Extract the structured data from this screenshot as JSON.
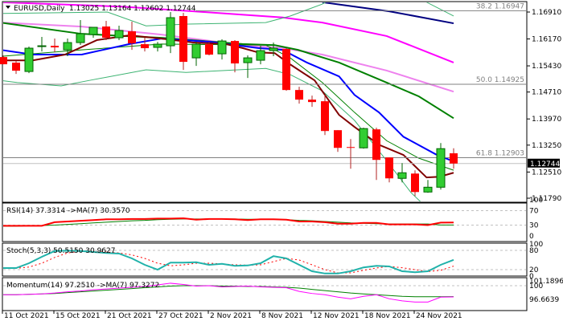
{
  "header": {
    "arrow_icon": "triangle-down-icon",
    "symbol": "EURUSD,Daily",
    "ohlc": "1.13025 1.13164 1.12602 1.12744"
  },
  "price_axis": {
    "ticks": [
      "1.16910",
      "1.16170",
      "1.15430",
      "1.14710",
      "1.13970",
      "1.13250",
      "1.12510",
      "1.11790"
    ],
    "tick_values": [
      1.1691,
      1.1617,
      1.1543,
      1.1471,
      1.1397,
      1.1325,
      1.1251,
      1.1179
    ],
    "current_price": "1.12744",
    "current_value": 1.12744
  },
  "fibo": [
    {
      "label": "38.2 1.16947",
      "value": 1.16947
    },
    {
      "label": "50.0 1.14925",
      "value": 1.14925
    },
    {
      "label": "61.8 1.12903",
      "value": 1.12903
    }
  ],
  "dates": [
    {
      "label": "11 Oct 2021",
      "idx": 0
    },
    {
      "label": "15 Oct 2021",
      "idx": 4
    },
    {
      "label": "21 Oct 2021",
      "idx": 8
    },
    {
      "label": "27 Oct 2021",
      "idx": 12
    },
    {
      "label": "2 Nov 2021",
      "idx": 16
    },
    {
      "label": "8 Nov 2021",
      "idx": 20
    },
    {
      "label": "12 Nov 2021",
      "idx": 24
    },
    {
      "label": "18 Nov 2021",
      "idx": 28
    },
    {
      "label": "24 Nov 2021",
      "idx": 32
    }
  ],
  "colors": {
    "bull": "#32cd32",
    "bear": "#ff0000",
    "outline": "#006400",
    "navy": "#000080",
    "magenta": "#ff00ff",
    "violet": "#ee82ee",
    "green": "#008000",
    "blue": "#0000ff",
    "maroon": "#800000",
    "bb": "#3cb371",
    "stoch": "#20b2aa",
    "grid": "#c0c0c0"
  },
  "chart_data": {
    "type": "candlestick",
    "title": "EURUSD,Daily",
    "ylim": [
      1.115,
      1.1725
    ],
    "candles": [
      [
        1.15672,
        1.15716,
        1.15474,
        1.15474
      ],
      [
        1.15518,
        1.15562,
        1.15208,
        1.15297
      ],
      [
        1.15275,
        1.1596,
        1.1523,
        1.15916
      ],
      [
        1.1596,
        1.16225,
        1.15827,
        1.15982
      ],
      [
        1.15982,
        1.16181,
        1.15805,
        1.15938
      ],
      [
        1.15871,
        1.16181,
        1.15695,
        1.1607
      ],
      [
        1.1607,
        1.16689,
        1.16004,
        1.16313
      ],
      [
        1.16291,
        1.16402,
        1.16203,
        1.1649
      ],
      [
        1.16512,
        1.16667,
        1.16137,
        1.16203
      ],
      [
        1.16203,
        1.16534,
        1.16137,
        1.16402
      ],
      [
        1.1638,
        1.16645,
        1.15871,
        1.16048
      ],
      [
        1.16026,
        1.16203,
        1.15827,
        1.15916
      ],
      [
        1.15938,
        1.16092,
        1.15827,
        1.16026
      ],
      [
        1.15982,
        1.1691,
        1.15783,
        1.16755
      ],
      [
        1.168,
        1.16888,
        1.15319,
        1.1554
      ],
      [
        1.1565,
        1.16092,
        1.15429,
        1.16026
      ],
      [
        1.16026,
        1.16092,
        1.15717,
        1.15739
      ],
      [
        1.15761,
        1.16159,
        1.15606,
        1.16114
      ],
      [
        1.16114,
        1.16137,
        1.15253,
        1.15496
      ],
      [
        1.15518,
        1.15717,
        1.15098,
        1.1565
      ],
      [
        1.15584,
        1.15982,
        1.15474,
        1.15849
      ],
      [
        1.15849,
        1.1607,
        1.15695,
        1.15916
      ],
      [
        1.15893,
        1.15916,
        1.14744,
        1.14766
      ],
      [
        1.14766,
        1.14855,
        1.14391,
        1.14501
      ],
      [
        1.14501,
        1.14612,
        1.14302,
        1.14435
      ],
      [
        1.14457,
        1.14634,
        1.13529,
        1.13639
      ],
      [
        1.13661,
        1.13661,
        1.13065,
        1.13175
      ],
      [
        1.13197,
        1.13418,
        1.12601,
        1.13175
      ],
      [
        1.13175,
        1.13728,
        1.13153,
        1.13705
      ],
      [
        1.13683,
        1.13728,
        1.12291,
        1.12844
      ],
      [
        1.1291,
        1.1291,
        1.12225,
        1.12336
      ],
      [
        1.12336,
        1.12755,
        1.12225,
        1.1249
      ],
      [
        1.12468,
        1.12557,
        1.11849,
        1.1196
      ],
      [
        1.1196,
        1.12291,
        1.11938,
        1.12092
      ],
      [
        1.12092,
        1.13308,
        1.12026,
        1.13153
      ],
      [
        1.13025,
        1.13164,
        1.12602,
        1.12744
      ]
    ],
    "lines": [
      {
        "name": "ma-navy",
        "color": "navy",
        "width": 2,
        "points": [
          [
            24.8,
            1.1718
          ],
          [
            30,
            1.1693
          ],
          [
            35,
            1.166
          ]
        ]
      },
      {
        "name": "ma-magenta",
        "color": "magenta",
        "width": 2,
        "points": [
          [
            -0.2,
            1.1718
          ],
          [
            9.2,
            1.1706
          ],
          [
            14.8,
            1.1693
          ],
          [
            21.7,
            1.1676
          ],
          [
            24.8,
            1.1662
          ],
          [
            29.8,
            1.1625
          ],
          [
            35,
            1.1552
          ]
        ]
      },
      {
        "name": "ma-violet",
        "color": "violet",
        "width": 2,
        "points": [
          [
            -0.2,
            1.1662
          ],
          [
            6.1,
            1.1651
          ],
          [
            12.3,
            1.1629
          ],
          [
            18.6,
            1.16
          ],
          [
            21.7,
            1.1592
          ],
          [
            24.8,
            1.1574
          ],
          [
            29.8,
            1.153
          ],
          [
            35,
            1.1472
          ]
        ]
      },
      {
        "name": "ma-green",
        "color": "green",
        "width": 2,
        "points": [
          [
            -0.2,
            1.1662
          ],
          [
            6.1,
            1.1631
          ],
          [
            12.3,
            1.162
          ],
          [
            18.6,
            1.1603
          ],
          [
            21.1,
            1.16
          ],
          [
            22.9,
            1.1587
          ],
          [
            26.1,
            1.1552
          ],
          [
            29.8,
            1.1497
          ],
          [
            32.3,
            1.1459
          ],
          [
            35,
            1.1399
          ]
        ]
      },
      {
        "name": "bb-upper",
        "color": "bb",
        "width": 1,
        "points": [
          [
            -0.2,
            1.1687
          ],
          [
            8.1,
            1.1691
          ],
          [
            11.1,
            1.1653
          ],
          [
            14.4,
            1.1658
          ],
          [
            20.4,
            1.1662
          ],
          [
            22.3,
            1.168
          ],
          [
            24.8,
            1.1713
          ],
          [
            26.1,
            1.174
          ],
          [
            32.2,
            1.174
          ],
          [
            32.9,
            1.1718
          ],
          [
            35,
            1.168
          ]
        ]
      },
      {
        "name": "bb-lower",
        "color": "bb",
        "width": 1,
        "points": [
          [
            -0.2,
            1.1503
          ],
          [
            1.1,
            1.1497
          ],
          [
            4.5,
            1.1488
          ],
          [
            6.7,
            1.1503
          ],
          [
            11.1,
            1.1532
          ],
          [
            14.2,
            1.1525
          ],
          [
            20.4,
            1.1536
          ],
          [
            22.3,
            1.1519
          ],
          [
            24.8,
            1.1474
          ],
          [
            27.3,
            1.1393
          ],
          [
            29.8,
            1.1282
          ],
          [
            31.7,
            1.1194
          ],
          [
            33,
            1.115
          ]
        ]
      },
      {
        "name": "bb-middle",
        "color": "green",
        "width": 1,
        "points": [
          [
            -0.2,
            1.1569
          ],
          [
            6.1,
            1.1587
          ],
          [
            12.3,
            1.1603
          ],
          [
            20.4,
            1.16
          ],
          [
            22.3,
            1.1565
          ],
          [
            24.8,
            1.1497
          ],
          [
            27.3,
            1.1415
          ],
          [
            29.8,
            1.1337
          ],
          [
            32.3,
            1.1289
          ],
          [
            35,
            1.1256
          ]
        ]
      },
      {
        "name": "ma-blue",
        "color": "blue",
        "width": 2,
        "points": [
          [
            -0.2,
            1.1587
          ],
          [
            2.3,
            1.1574
          ],
          [
            6.1,
            1.1574
          ],
          [
            9.8,
            1.1603
          ],
          [
            12.3,
            1.1618
          ],
          [
            16.1,
            1.1609
          ],
          [
            19.8,
            1.1592
          ],
          [
            21.7,
            1.1587
          ],
          [
            23.6,
            1.1552
          ],
          [
            26.1,
            1.1514
          ],
          [
            27.3,
            1.1463
          ],
          [
            29.2,
            1.1415
          ],
          [
            31.1,
            1.1348
          ],
          [
            33.6,
            1.13
          ],
          [
            35,
            1.128
          ]
        ]
      },
      {
        "name": "ma-maroon",
        "color": "maroon",
        "width": 2,
        "points": [
          [
            -0.2,
            1.1558
          ],
          [
            2.3,
            1.1558
          ],
          [
            4.8,
            1.1574
          ],
          [
            7.3,
            1.1614
          ],
          [
            9.8,
            1.1627
          ],
          [
            12.3,
            1.1618
          ],
          [
            14.8,
            1.1607
          ],
          [
            17.3,
            1.1603
          ],
          [
            18.6,
            1.1592
          ],
          [
            19.8,
            1.158
          ],
          [
            21.1,
            1.1578
          ],
          [
            22.3,
            1.1547
          ],
          [
            24.2,
            1.1503
          ],
          [
            26.1,
            1.1408
          ],
          [
            27.3,
            1.1375
          ],
          [
            29.2,
            1.1326
          ],
          [
            31.1,
            1.1298
          ],
          [
            32.9,
            1.1236
          ],
          [
            33.9,
            1.1238
          ],
          [
            35,
            1.1249
          ]
        ]
      }
    ],
    "rsi": {
      "label": "RSI(14) 37.3314  ->MA(7) 30.3570",
      "levels": [
        "100",
        "70",
        "30",
        "0"
      ],
      "level_values": [
        100,
        70,
        30,
        0
      ],
      "values": [
        28,
        28,
        28,
        28,
        38,
        40,
        42,
        44,
        46,
        46,
        47,
        47,
        48,
        48,
        49,
        45,
        47,
        47,
        46,
        44,
        46,
        46,
        45,
        40,
        40,
        38,
        34,
        34,
        36,
        36,
        32,
        32,
        32,
        30,
        37,
        37.33
      ],
      "ma": [
        27,
        27,
        28,
        29,
        30,
        32,
        34,
        36,
        38,
        40,
        42,
        43,
        45,
        46,
        47,
        47,
        47,
        47,
        47,
        46,
        46,
        46,
        45,
        43,
        42,
        40,
        38,
        36,
        35,
        34,
        33,
        33,
        33,
        33,
        30.4,
        30.36
      ]
    },
    "stoch": {
      "label": "Stoch(5,3,3) 50.5150 30.9627",
      "levels": [
        "100",
        "80",
        "20",
        "0"
      ],
      "level_values": [
        100,
        80,
        20,
        0
      ],
      "k": [
        25,
        25,
        40,
        60,
        78,
        79,
        78,
        75,
        72,
        70,
        55,
        35,
        20,
        42,
        42,
        43,
        35,
        38,
        32,
        33,
        40,
        62,
        55,
        35,
        15,
        8,
        8,
        15,
        27,
        32,
        30,
        15,
        12,
        15,
        35,
        50.5
      ],
      "d": [
        24,
        24,
        28,
        40,
        58,
        72,
        78,
        77,
        75,
        72,
        66,
        55,
        40,
        32,
        35,
        40,
        40,
        38,
        35,
        34,
        35,
        45,
        55,
        50,
        35,
        20,
        10,
        10,
        18,
        25,
        30,
        26,
        20,
        14,
        18,
        31
      ]
    },
    "momentum": {
      "label": "Momentum(14) 97.2510  ->MA(7) 97.3272",
      "levels": [
        "101.1896",
        "100",
        "96.6639"
      ],
      "level_values": [
        101.1896,
        100,
        96.6639
      ],
      "values": [
        97.8,
        97.8,
        97.9,
        98.0,
        98.2,
        98.5,
        98.7,
        99.0,
        99.2,
        99.4,
        99.6,
        99.8,
        100.2,
        100.6,
        100.3,
        99.9,
        100.0,
        99.7,
        99.8,
        99.9,
        99.7,
        99.6,
        99.5,
        98.6,
        98.1,
        97.8,
        97.2,
        96.8,
        97.4,
        97.8,
        96.8,
        96.3,
        96.0,
        96.0,
        97.2,
        97.25
      ],
      "ma": [
        97.8,
        97.8,
        97.9,
        98.0,
        98.1,
        98.3,
        98.5,
        98.7,
        98.9,
        99.1,
        99.3,
        99.5,
        99.7,
        99.9,
        100.0,
        100.0,
        100.0,
        99.9,
        99.9,
        99.8,
        99.8,
        99.7,
        99.6,
        99.4,
        99.1,
        98.8,
        98.5,
        98.2,
        98.0,
        97.8,
        97.6,
        97.4,
        97.3,
        97.3,
        97.3,
        97.33
      ]
    }
  }
}
